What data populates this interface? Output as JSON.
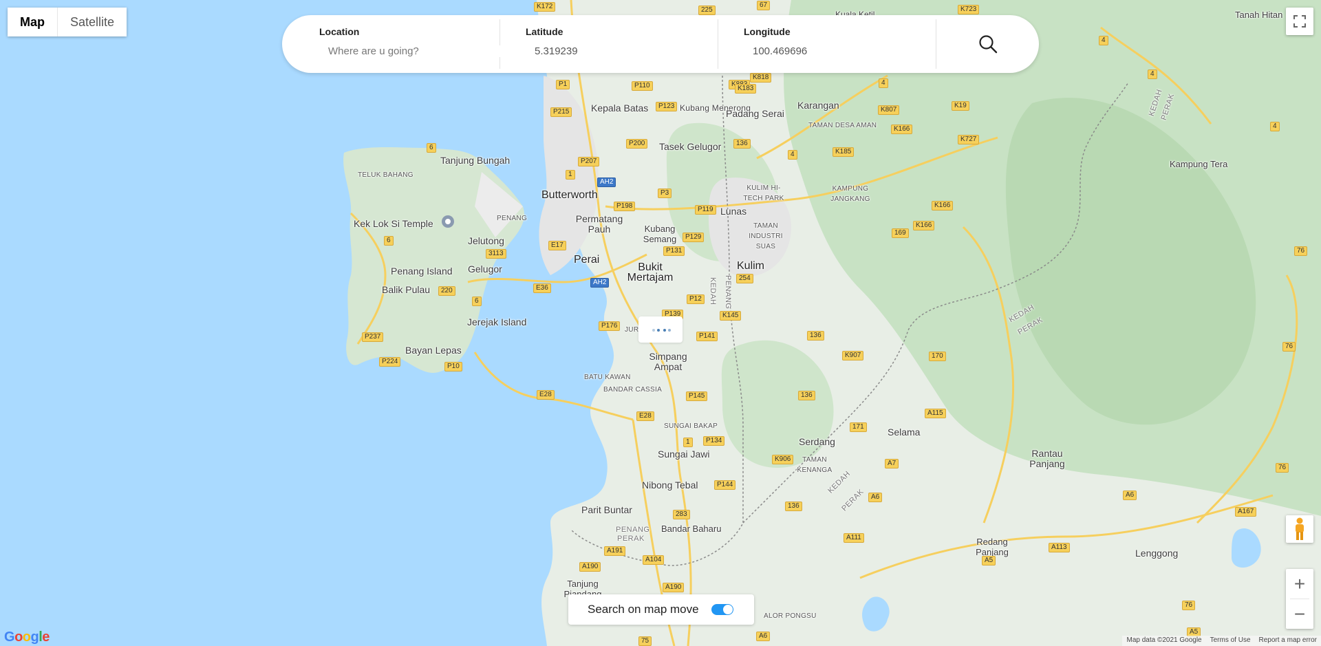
{
  "map_type": {
    "map_label": "Map",
    "satellite_label": "Satellite",
    "selected": "Map"
  },
  "search": {
    "location_label": "Location",
    "location_placeholder": "Where are u going?",
    "latitude_label": "Latitude",
    "latitude_value": "5.319239",
    "longitude_label": "Longitude",
    "longitude_value": "100.469696"
  },
  "toggle": {
    "label": "Search on map move",
    "on": true
  },
  "footer": {
    "map_data": "Map data ©2021 Google",
    "terms": "Terms of Use",
    "report": "Report a map error"
  },
  "colors": {
    "toggle_on": "#2196f3",
    "water": "#aadaff",
    "land": "#e8eee6",
    "road": "#f6d05a"
  },
  "places": {
    "butterworth": "Butterworth",
    "kepala_batas": "Kepala Batas",
    "kubang_menerong": "Kubang Menerong",
    "padang_serai": "Padang Serai",
    "karangan": "Karangan",
    "taman_desa_aman": "TAMAN DESA AMAN",
    "tasek_gelugor": "Tasek Gelugor",
    "tanjung_bungah": "Tanjung Bungah",
    "teluk_bahang": "TELUK BAHANG",
    "kek_lok_si": "Kek Lok Si Temple",
    "penang_label": "PENANG",
    "jelutong": "Jelutong",
    "gelugor": "Gelugor",
    "penang_island": "Penang Island",
    "balik_pulau": "Balik Pulau",
    "jerejak": "Jerejak Island",
    "bayan_lepas": "Bayan Lepas",
    "permatang_pauh": "Permatang Pauh",
    "kubang_semang": "Kubang Semang",
    "lunas": "Lunas",
    "kulim_htp": "KULIM HI-TECH PARK",
    "taman_industri": "TAMAN INDUSTRI SUAS",
    "kampung_jangkang": "KAMPUNG JANGKANG",
    "perai": "Perai",
    "bukit_mertajam": "Bukit Mertajam",
    "kulim": "Kulim",
    "simpang_ampat": "Simpang Ampat",
    "batu_kawan": "BATU KAWAN",
    "bandar_cassia": "BANDAR CASSIA",
    "sungai_bakap": "SUNGAI BAKAP",
    "sungai_jawi": "Sungai Jawi",
    "nibong_tebal": "Nibong Tebal",
    "parit_buntar": "Parit Buntar",
    "bandar_baharu": "Bandar Baharu",
    "tanjung_piandang": "Tanjung Piandang",
    "serdang": "Serdang",
    "taman_kenanga": "TAMAN KENANGA",
    "selama": "Selama",
    "rantau_panjang": "Rantau Panjang",
    "redang_panjang": "Redang Panjang",
    "lenggong": "Lenggong",
    "kampung_tera": "Kampung Tera",
    "tanah_hitam": "Tanah Hitan",
    "kuala_ketil": "Kuala Ketil",
    "alor_pongsu": "ALOR PONGSU",
    "kedah": "KEDAH",
    "perak": "PERAK",
    "jurong_label": "JURU"
  },
  "shields": [
    "P1",
    "P110",
    "P215",
    "P123",
    "P200",
    "P207",
    "P3",
    "P198",
    "P119",
    "P129",
    "P131",
    "E17",
    "E36",
    "AH2",
    "P12",
    "P139",
    "P176",
    "P141",
    "K145",
    "E28",
    "P145",
    "P134",
    "P10",
    "P224",
    "P237",
    "220",
    "3113",
    "6",
    "4",
    "K807",
    "K19",
    "K166",
    "K185",
    "K727",
    "169",
    "136",
    "K907",
    "170",
    "A115",
    "171",
    "A7",
    "K906",
    "A6",
    "A111",
    "A113",
    "76",
    "A167",
    "A5",
    "283",
    "P144",
    "A191",
    "A104",
    "A190",
    "75",
    "K883",
    "K818",
    "K183",
    "K172",
    "225",
    "67",
    "K723",
    "254",
    "1",
    "A190"
  ]
}
